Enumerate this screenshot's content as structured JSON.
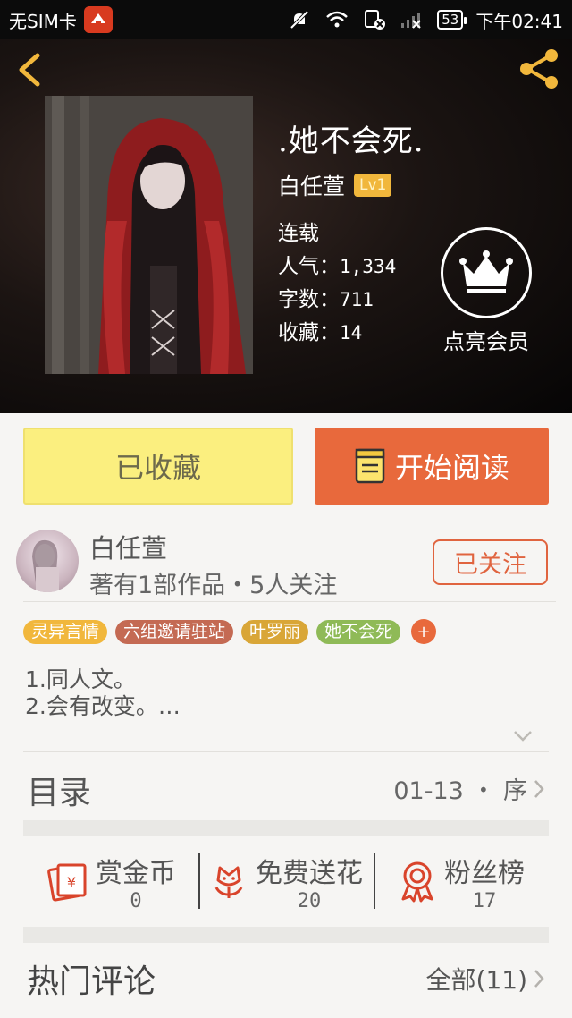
{
  "status_bar": {
    "carrier": "无SIM卡",
    "battery": "53",
    "time": "下午02:41"
  },
  "book": {
    "title": ".她不会死.",
    "author": "白任萱",
    "level": "Lv1",
    "status": "连载",
    "popularity_label": "人气：",
    "popularity": "1,334",
    "words_label": "字数：",
    "words": "711",
    "favorites_label": "收藏：",
    "favorites": "14"
  },
  "vip": {
    "label": "点亮会员"
  },
  "actions": {
    "collected_label": "已收藏",
    "read_label": "开始阅读"
  },
  "author_card": {
    "name": "白任萱",
    "meta": "著有1部作品・5人关注",
    "follow_label": "已关注"
  },
  "tags": [
    {
      "label": "灵异言情",
      "color": "#f1b73c"
    },
    {
      "label": "六组邀请驻站",
      "color": "#c46a53"
    },
    {
      "label": "叶罗丽",
      "color": "#d9a637"
    },
    {
      "label": "她不会死",
      "color": "#8fba57"
    }
  ],
  "tag_add": "+",
  "description": {
    "line1": "1.同人文。",
    "line2": "2.会有改变。…"
  },
  "catalog": {
    "title": "目录",
    "range": "01-13 ・ 序"
  },
  "rewards": [
    {
      "label": "赏金币",
      "count": "0",
      "icon": "red-envelope-icon"
    },
    {
      "label": "免费送花",
      "count": "20",
      "icon": "flower-icon"
    },
    {
      "label": "粉丝榜",
      "count": "17",
      "icon": "medal-icon"
    }
  ],
  "comments": {
    "title": "热门评论",
    "all_label": "全部(11)"
  },
  "colors": {
    "accent": "#e8693c",
    "collected_bg": "#fbef7f",
    "icon_red": "#d9442b"
  }
}
